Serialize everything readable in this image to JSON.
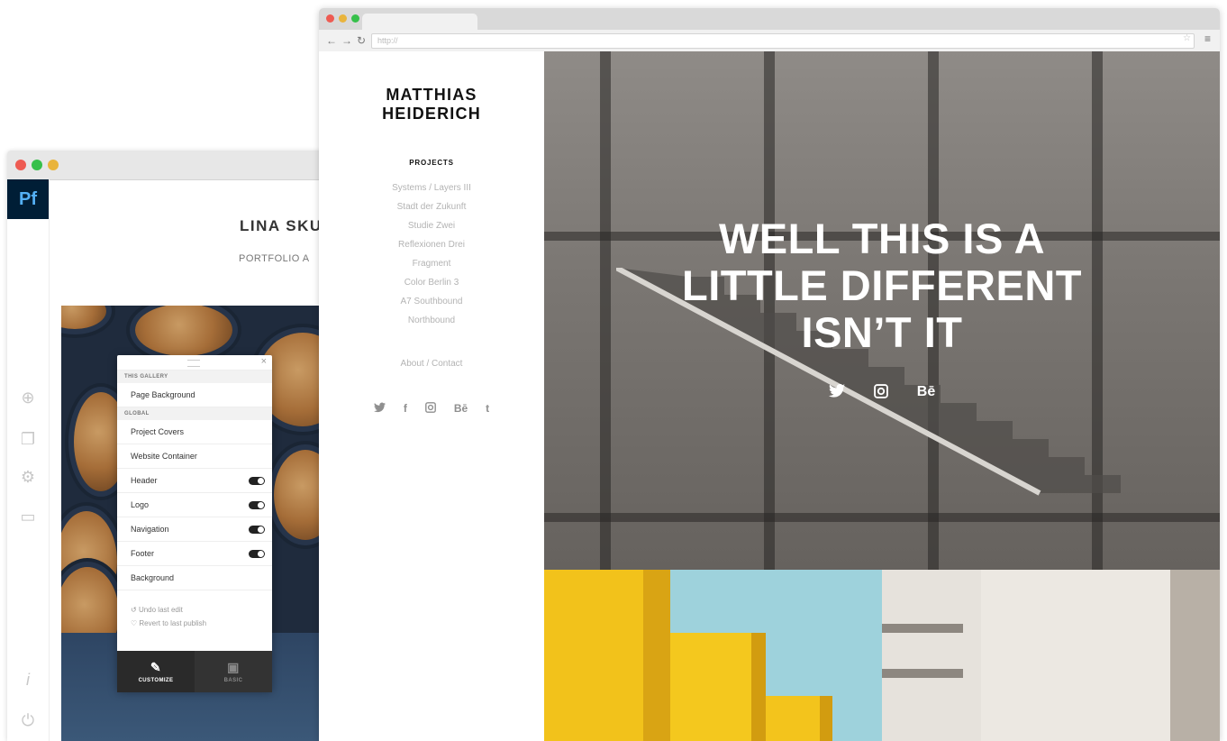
{
  "editor": {
    "logo": "Pf",
    "site_name": "LINA SKU",
    "nav": "PORTFOLIO   A",
    "panel": {
      "section_gallery": "THIS GALLERY",
      "page_background": "Page Background",
      "section_global": "GLOBAL",
      "rows": [
        {
          "label": "Project Covers",
          "toggle": false
        },
        {
          "label": "Website Container",
          "toggle": false
        },
        {
          "label": "Header",
          "toggle": true
        },
        {
          "label": "Logo",
          "toggle": true
        },
        {
          "label": "Navigation",
          "toggle": true
        },
        {
          "label": "Footer",
          "toggle": true
        },
        {
          "label": "Background",
          "toggle": false
        }
      ],
      "undo": "Undo last edit",
      "revert": "Revert to last publish",
      "tab_customize": "CUSTOMIZE",
      "tab_basic": "BASIC"
    }
  },
  "browser": {
    "url": "http://",
    "site": {
      "brand_line1": "MATTHIAS",
      "brand_line2": "HEIDERICH",
      "projects_title": "PROJECTS",
      "projects": [
        "Systems / Layers III",
        "Stadt der Zukunft",
        "Studie Zwei",
        "Reflexionen Drei",
        "Fragment",
        "Color Berlin 3",
        "A7 Southbound",
        "Northbound"
      ],
      "about": "About / Contact",
      "social_glyphs": {
        "twitter": "🐦",
        "facebook": "f",
        "instagram": "◫",
        "behance": "Bē",
        "tumblr": "t"
      },
      "hero_line1": "WELL THIS IS A",
      "hero_line2": "LITTLE DIFFERENT",
      "hero_line3": "ISN’T IT",
      "hero_social_behance": "Bē"
    }
  }
}
